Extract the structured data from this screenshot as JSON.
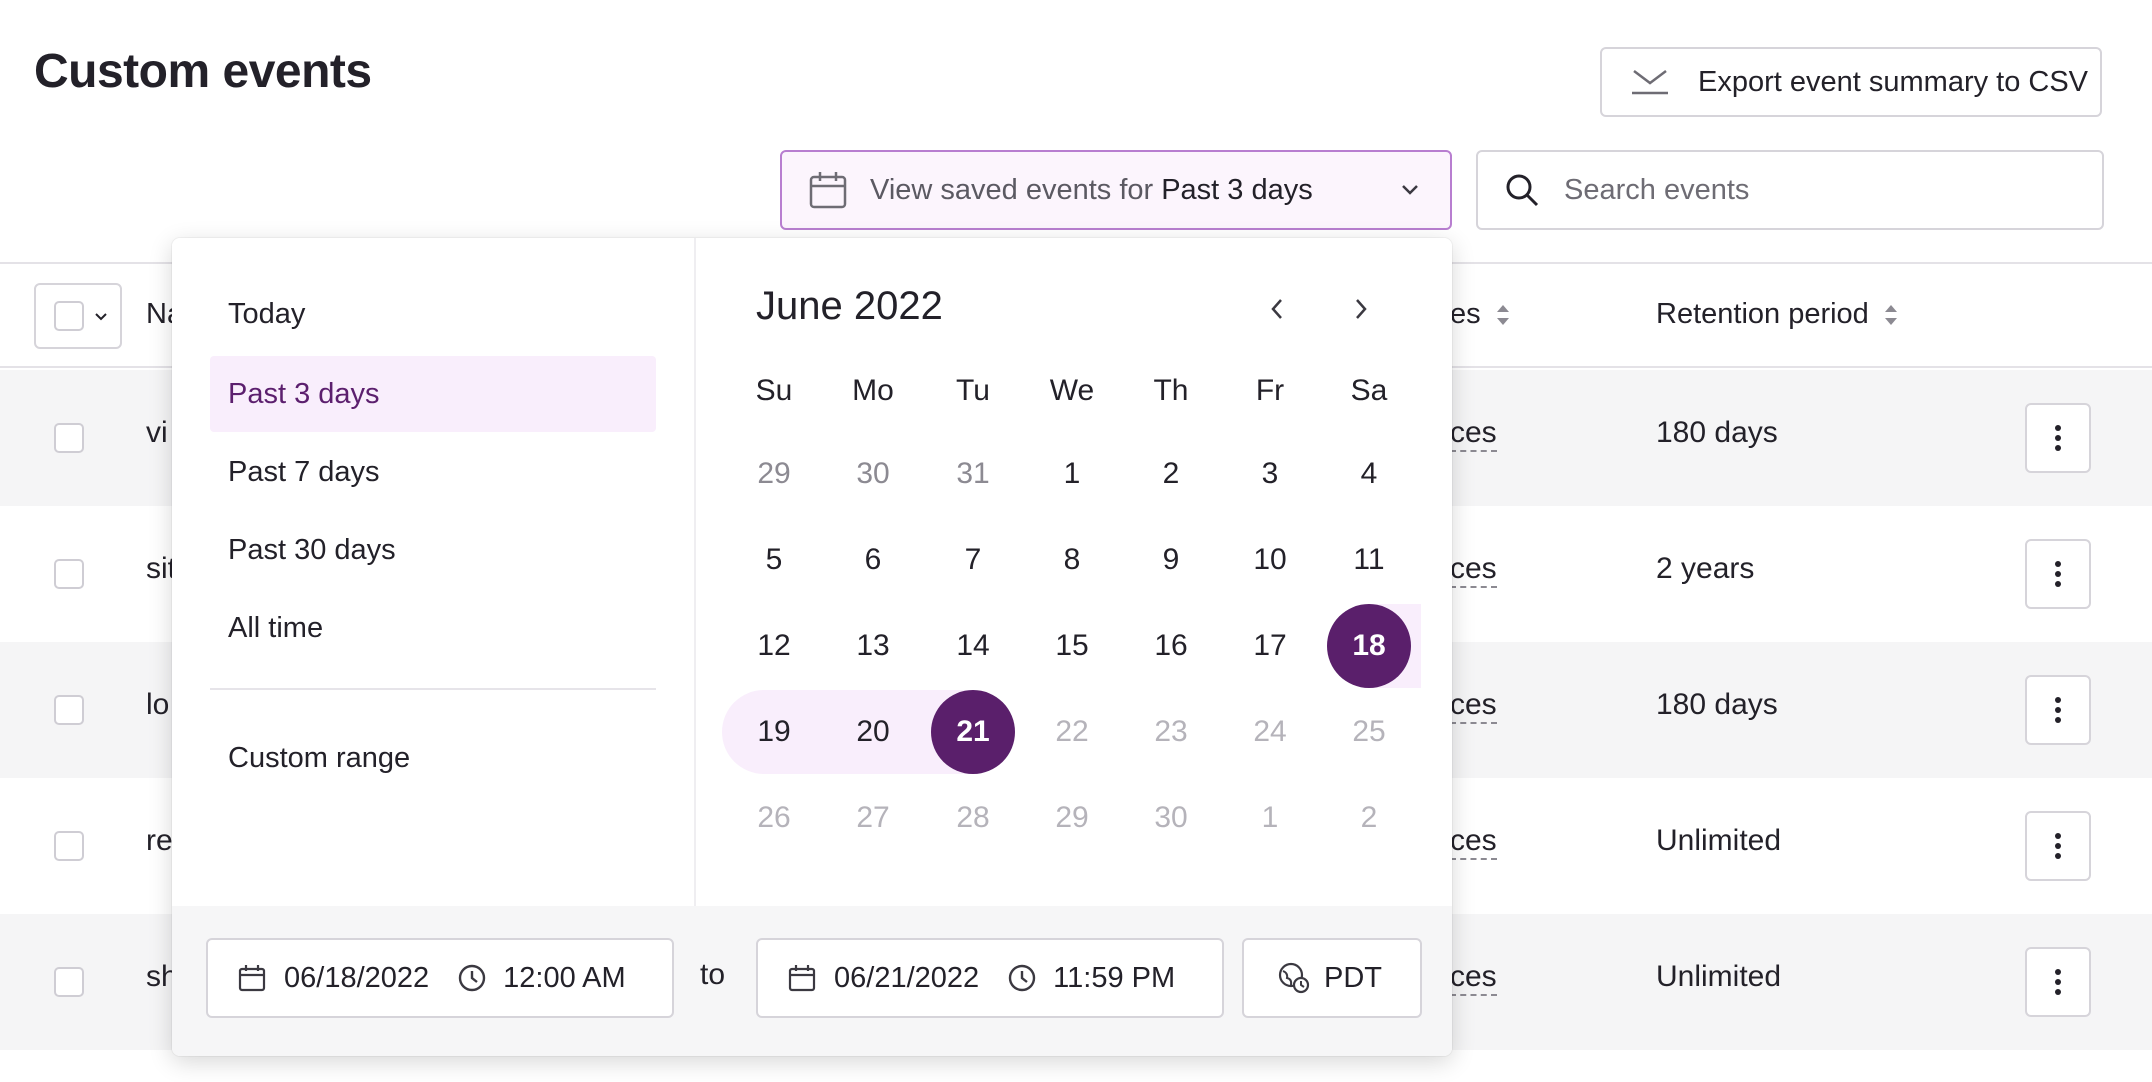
{
  "header": {
    "title": "Custom events",
    "export_label": "Export event summary to CSV",
    "period_prefix": "View saved events for",
    "period_value": "Past 3 days",
    "search_placeholder": "Search events"
  },
  "table": {
    "columns": {
      "name": "Na",
      "devices": "es",
      "retention": "Retention period"
    },
    "rows": [
      {
        "name": "vi",
        "devices": "ces",
        "retention": "180 days"
      },
      {
        "name": "sit",
        "devices": "ces",
        "retention": "2 years"
      },
      {
        "name": "lo",
        "devices": "ces",
        "retention": "180 days"
      },
      {
        "name": "re",
        "devices": "ces",
        "retention": "Unlimited"
      },
      {
        "name": "sh",
        "devices": "ces",
        "retention": "Unlimited"
      }
    ]
  },
  "picker": {
    "presets": [
      "Today",
      "Past 3 days",
      "Past 7 days",
      "Past 30 days",
      "All time"
    ],
    "active_preset": "Past 3 days",
    "custom_range": "Custom range",
    "month_label": "June 2022",
    "weekdays": [
      "Su",
      "Mo",
      "Tu",
      "We",
      "Th",
      "Fr",
      "Sa"
    ],
    "weeks": [
      [
        "29",
        "30",
        "31",
        "1",
        "2",
        "3",
        "4"
      ],
      [
        "5",
        "6",
        "7",
        "8",
        "9",
        "10",
        "11"
      ],
      [
        "12",
        "13",
        "14",
        "15",
        "16",
        "17",
        "18"
      ],
      [
        "19",
        "20",
        "21",
        "22",
        "23",
        "24",
        "25"
      ],
      [
        "26",
        "27",
        "28",
        "29",
        "30",
        "1",
        "2"
      ]
    ],
    "range_start_day": "18",
    "range_end_day": "21",
    "start_date": "06/18/2022",
    "start_time": "12:00 AM",
    "to_label": "to",
    "end_date": "06/21/2022",
    "end_time": "11:59 PM",
    "timezone": "PDT"
  },
  "colors": {
    "accent": "#5a1f6b",
    "accent_light": "#f9eefc",
    "accent_border": "#b87ed0"
  }
}
